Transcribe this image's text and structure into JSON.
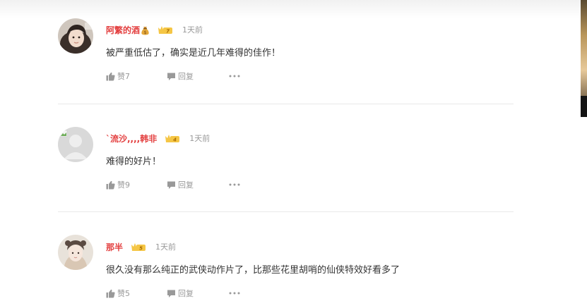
{
  "comments": [
    {
      "username": "阿繁的酒",
      "has_emoji_badge": true,
      "level": "7",
      "time": "1天前",
      "text": "被严重低估了，确实是近几年难得的佳作！",
      "likes_label": "赞7",
      "reply_label": "回复"
    },
    {
      "username": "`流沙,,,,韩非",
      "has_emoji_badge": false,
      "level": "4",
      "time": "1天前",
      "text": "难得的好片！",
      "likes_label": "赞9",
      "reply_label": "回复"
    },
    {
      "username": "那半",
      "has_emoji_badge": false,
      "level": "5",
      "time": "1天前",
      "text": "很久没有那么纯正的武侠动作片了，比那些花里胡哨的仙侠特效好看多了",
      "likes_label": "赞5",
      "reply_label": "回复"
    }
  ],
  "colors": {
    "username": "#e33e3e",
    "meta": "#999999",
    "text": "#333333",
    "badge_gold": "#f5c645",
    "divider": "#e9e9e9"
  },
  "icons": {
    "like": "thumb-up-icon",
    "reply": "speech-bubble-icon",
    "more": "more-dots-icon"
  }
}
